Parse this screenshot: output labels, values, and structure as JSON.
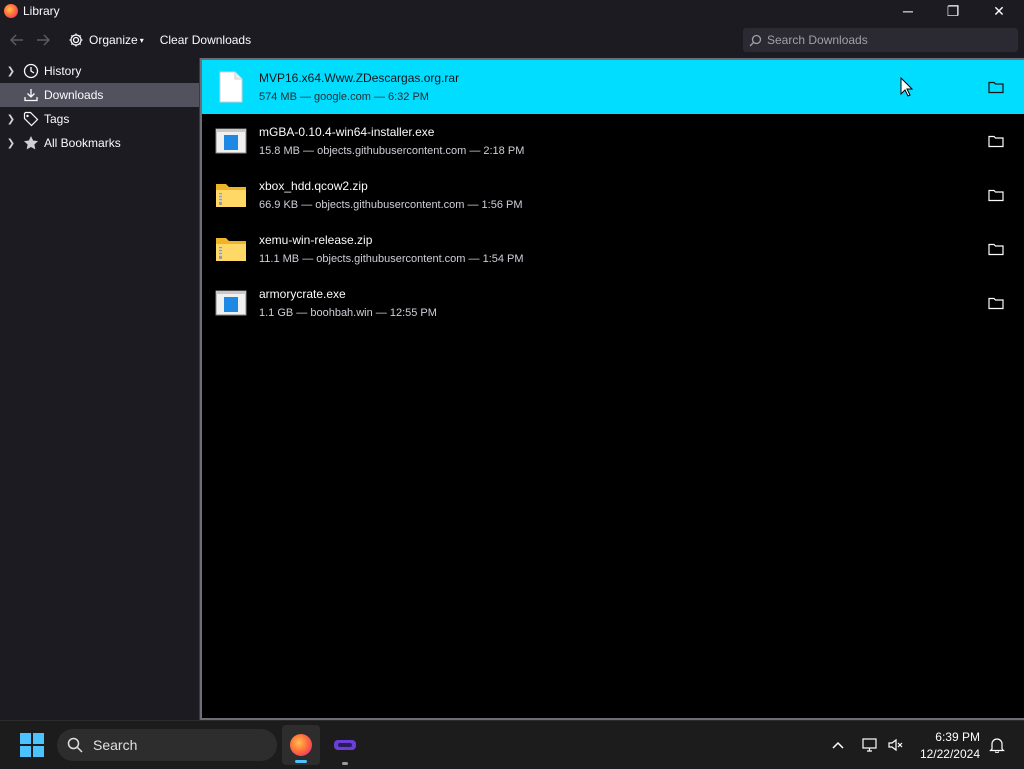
{
  "window": {
    "title": "Library",
    "controls": {
      "minimize": "─",
      "maximize": "❐",
      "close": "✕"
    }
  },
  "toolbar": {
    "back_icon": "arrow-left-icon",
    "forward_icon": "arrow-right-icon",
    "organize_label": "Organize",
    "clear_downloads_label": "Clear Downloads",
    "search_placeholder": "Search Downloads"
  },
  "sidebar": {
    "items": [
      {
        "label": "History",
        "icon": "clock-icon",
        "twisty": true,
        "selected": false
      },
      {
        "label": "Downloads",
        "icon": "download-icon",
        "twisty": false,
        "selected": true
      },
      {
        "label": "Tags",
        "icon": "tag-icon",
        "twisty": true,
        "selected": false
      },
      {
        "label": "All Bookmarks",
        "icon": "star-icon",
        "twisty": true,
        "selected": false
      }
    ]
  },
  "downloads": [
    {
      "name": "MVP16.x64.Www.ZDescargas.org.rar",
      "meta": "574 MB — google.com — 6:32 PM",
      "icon": "generic-file-icon",
      "selected": true
    },
    {
      "name": "mGBA-0.10.4-win64-installer.exe",
      "meta": "15.8 MB — objects.githubusercontent.com — 2:18 PM",
      "icon": "exe-file-icon",
      "selected": false
    },
    {
      "name": "xbox_hdd.qcow2.zip",
      "meta": "66.9 KB — objects.githubusercontent.com — 1:56 PM",
      "icon": "zip-folder-icon",
      "selected": false
    },
    {
      "name": "xemu-win-release.zip",
      "meta": "11.1 MB — objects.githubusercontent.com — 1:54 PM",
      "icon": "zip-folder-icon",
      "selected": false
    },
    {
      "name": "armorycrate.exe",
      "meta": "1.1 GB — boohbah.win — 12:55 PM",
      "icon": "exe-file-icon",
      "selected": false
    }
  ],
  "taskbar": {
    "search_label": "Search",
    "time": "6:39 PM",
    "date": "12/22/2024"
  },
  "colors": {
    "selection": "#00ddff",
    "window_bg": "#1c1b22",
    "list_bg": "#000000",
    "sidebar_selected": "#52525e"
  }
}
